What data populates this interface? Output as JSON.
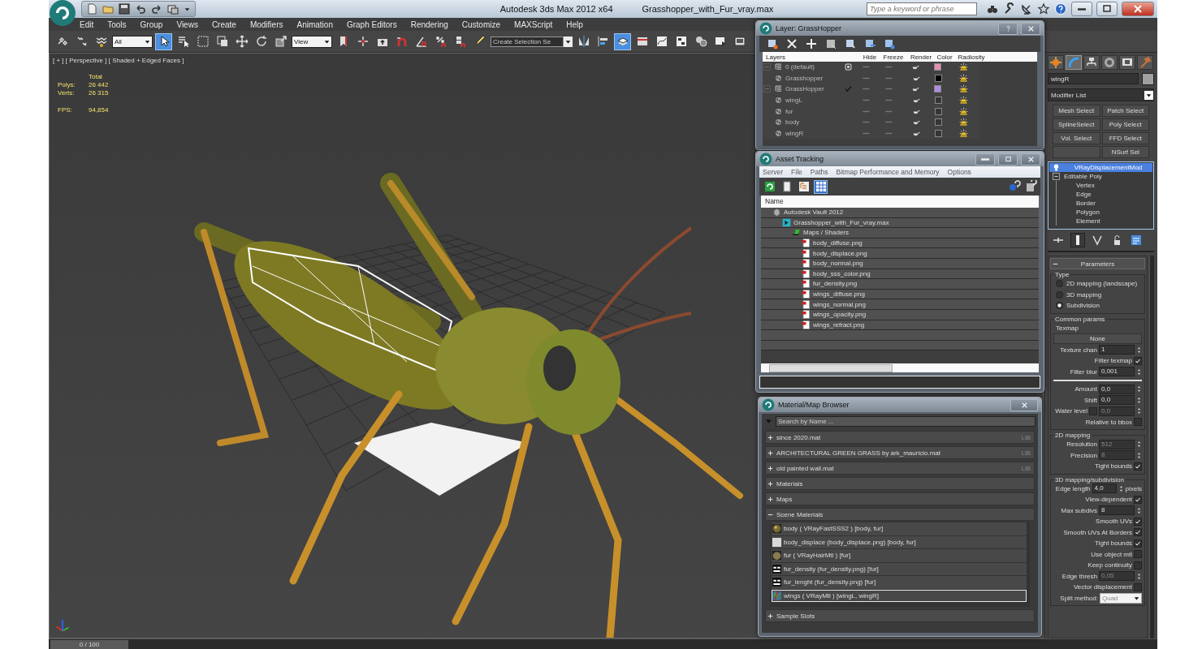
{
  "title_bar": {
    "app_name": "Autodesk 3ds Max 2012 x64",
    "file_name": "Grasshopper_with_Fur_vray.max",
    "search": {
      "placeholder": "Type a keyword or phrase"
    }
  },
  "menu": [
    "Edit",
    "Tools",
    "Group",
    "Views",
    "Create",
    "Modifiers",
    "Animation",
    "Graph Editors",
    "Rendering",
    "Customize",
    "MAXScript",
    "Help"
  ],
  "toolbar": {
    "items": [
      {
        "kind": "icon",
        "selected": false
      },
      {
        "kind": "icon",
        "selected": false
      },
      {
        "kind": "icon",
        "selected": false
      },
      {
        "kind": "dropdown",
        "value": "All"
      },
      {
        "kind": "icon",
        "selected": true
      },
      {
        "kind": "icon",
        "selected": false
      },
      {
        "kind": "icon",
        "selected": false
      },
      {
        "kind": "icon",
        "selected": false
      },
      {
        "kind": "icon",
        "selected": false
      },
      {
        "kind": "icon",
        "selected": false
      },
      {
        "kind": "icon",
        "selected": false
      },
      {
        "kind": "dropdown",
        "value": "View"
      },
      {
        "kind": "icon",
        "selected": false
      },
      {
        "kind": "icon",
        "selected": false
      },
      {
        "kind": "icon",
        "selected": false
      },
      {
        "kind": "icon",
        "selected": false
      },
      {
        "kind": "icon",
        "selected": false
      },
      {
        "kind": "icon",
        "selected": false
      },
      {
        "kind": "icon",
        "selected": false
      },
      {
        "kind": "icon",
        "selected": false
      },
      {
        "kind": "field",
        "placeholder": "Create Selection Se"
      },
      {
        "kind": "icon",
        "selected": false
      },
      {
        "kind": "icon",
        "selected": false
      },
      {
        "kind": "icon",
        "selected": true
      },
      {
        "kind": "icon",
        "selected": false
      },
      {
        "kind": "icon",
        "selected": false
      },
      {
        "kind": "icon",
        "selected": false
      },
      {
        "kind": "icon",
        "selected": false
      },
      {
        "kind": "icon",
        "selected": false
      },
      {
        "kind": "icon",
        "selected": false
      }
    ]
  },
  "viewport": {
    "label": "[ + ] [ Perspective ] [ Shaded + Edged Faces ]",
    "stats_header": "Total",
    "stats": [
      {
        "label": "Polys:",
        "value": "26 442"
      },
      {
        "label": "Verts:",
        "value": "26 315"
      }
    ],
    "fps": {
      "label": "FPS:",
      "value": "94,854"
    }
  },
  "layer_dialog": {
    "title": "Layer: GrassHopper",
    "columns": [
      "Layers",
      "Hide",
      "Freeze",
      "Render",
      "Color",
      "Radiosity"
    ],
    "layers": [
      {
        "name": "0 (default)",
        "expanded": true,
        "current": false,
        "color": "#e890b4",
        "children": [
          {
            "name": "Grasshopper",
            "color": "#000000"
          }
        ]
      },
      {
        "name": "GrassHopper",
        "expanded": true,
        "current": true,
        "color": "#b08ce0",
        "children": [
          {
            "name": "wingL",
            "color": "#353535"
          },
          {
            "name": "fur",
            "color": "#353535"
          },
          {
            "name": "body",
            "color": "#353535"
          },
          {
            "name": "wingR",
            "color": "#353535"
          }
        ]
      }
    ]
  },
  "asset_tracking": {
    "title": "Asset Tracking",
    "menu": [
      "Server",
      "File",
      "Paths",
      "Bitmap Performance and Memory",
      "Options"
    ],
    "tools": [
      {
        "selected": false
      },
      {
        "selected": false
      },
      {
        "selected": false
      },
      {
        "selected": true
      }
    ],
    "column": "Name",
    "tree": [
      {
        "name": "Autodesk Vault 2012",
        "kind": "vault",
        "children": [
          {
            "name": "Grasshopper_with_Fur_vray.max",
            "kind": "scene",
            "children": [
              {
                "name": "Maps / Shaders",
                "kind": "folder",
                "children": [
                  {
                    "name": "body_diffuse.png",
                    "kind": "bitmap"
                  },
                  {
                    "name": "body_displace.png",
                    "kind": "bitmap"
                  },
                  {
                    "name": "body_normal.png",
                    "kind": "bitmap"
                  },
                  {
                    "name": "body_sss_color.png",
                    "kind": "bitmap"
                  },
                  {
                    "name": "fur_density.png",
                    "kind": "bitmap"
                  },
                  {
                    "name": "wings_diffuse.png",
                    "kind": "bitmap"
                  },
                  {
                    "name": "wings_normal.png",
                    "kind": "bitmap"
                  },
                  {
                    "name": "wings_opacity.png",
                    "kind": "bitmap"
                  },
                  {
                    "name": "wings_refract.png",
                    "kind": "bitmap"
                  }
                ]
              }
            ]
          }
        ]
      }
    ]
  },
  "material_browser": {
    "title": "Material/Map Browser",
    "search": {
      "placeholder": "Search by Name ..."
    },
    "groups": [
      {
        "label": "since 2020.mat",
        "expanded": false,
        "badge": "LIB"
      },
      {
        "label": "ARCHITECTURAL GREEN GRASS by ark_mauricio.mat",
        "expanded": false,
        "badge": "LIB"
      },
      {
        "label": "old painted wall.mat",
        "expanded": false,
        "badge": "LIB"
      },
      {
        "label": "Materials",
        "expanded": false
      },
      {
        "label": "Maps",
        "expanded": false
      },
      {
        "label": "Scene Materials",
        "expanded": true,
        "items": [
          {
            "label": "body  ( VRayFastSSS2 ) [body, fur]",
            "kind": "sphere",
            "selected": false
          },
          {
            "label": "body_displace (body_displace.png) [body, fur]",
            "kind": "swatch",
            "selected": false
          },
          {
            "label": "fur  ( VRayHairMtl ) [fur]",
            "kind": "fur",
            "selected": false
          },
          {
            "label": "fur_density (fur_density.png)  [fur]",
            "kind": "map",
            "selected": false
          },
          {
            "label": "fur_lenght (fur_density.png)  [fur]",
            "kind": "map",
            "selected": false
          },
          {
            "label": "wings  ( VRayMtl ) [wingL, wingR]",
            "kind": "noise",
            "selected": true
          }
        ]
      },
      {
        "label": "Sample Slots",
        "expanded": false
      }
    ]
  },
  "command_panel": {
    "tabs": [
      {
        "selected": false
      },
      {
        "selected": true
      },
      {
        "selected": false
      },
      {
        "selected": false
      },
      {
        "selected": false
      },
      {
        "selected": false
      }
    ],
    "object_name": "wingR",
    "modifier_list": "Modifier List",
    "modifier_buttons": [
      {
        "kind": "button",
        "label": "Mesh Select"
      },
      {
        "kind": "button",
        "label": "Patch Select"
      },
      {
        "kind": "button",
        "label": "SplineSelect"
      },
      {
        "kind": "button",
        "label": "Poly Select"
      },
      {
        "kind": "button",
        "label": "Vol. Select"
      },
      {
        "kind": "button",
        "label": "FFD Select"
      },
      {
        "kind": "blank"
      },
      {
        "kind": "button",
        "label": "NSurf Sel"
      }
    ],
    "stack": [
      {
        "label": "VRayDisplacementMod",
        "kind": "modifier",
        "selected": true
      },
      {
        "label": "Editable Poly",
        "kind": "base",
        "selected": false,
        "expanded": true,
        "children": [
          "Vertex",
          "Edge",
          "Border",
          "Polygon",
          "Element"
        ]
      }
    ],
    "stack_tools": [
      {
        "selected": false
      },
      {
        "selected": true
      },
      {
        "selected": false
      },
      {
        "selected": false
      },
      {
        "selected": false
      }
    ],
    "rollout": {
      "title": "Parameters",
      "expanded": true,
      "groups": [
        {
          "title": "Type",
          "rows": [
            {
              "kind": "radio",
              "label": "2D mapping (landscape)",
              "selected": false
            },
            {
              "kind": "radio",
              "label": "3D mapping",
              "selected": false
            },
            {
              "kind": "radio",
              "label": "Subdivision",
              "selected": true
            }
          ]
        },
        {
          "title": "Common params",
          "rows": [
            {
              "kind": "label",
              "label": "Texmap"
            },
            {
              "kind": "button",
              "label": "None"
            },
            {
              "kind": "spinner",
              "label": "Texture chan",
              "value": "1",
              "disabled": false
            },
            {
              "kind": "checkbox",
              "label": "Filter texmap",
              "checked": true
            },
            {
              "kind": "spinner",
              "label": "Filter blur",
              "value": "0,001",
              "disabled": false
            },
            {
              "kind": "divider"
            },
            {
              "kind": "spinner",
              "label": "Amount",
              "value": "0,0",
              "disabled": false
            },
            {
              "kind": "spinner",
              "label": "Shift",
              "value": "0,0",
              "disabled": false
            },
            {
              "kind": "checkspinner",
              "label": "Water level",
              "checked": false,
              "value": "0,0",
              "disabled": true
            },
            {
              "kind": "checkbox",
              "label": "Relative to bbox",
              "checked": false
            }
          ]
        },
        {
          "title": "2D mapping",
          "rows": [
            {
              "kind": "spinner",
              "label": "Resolution",
              "value": "512",
              "disabled": true
            },
            {
              "kind": "spinner",
              "label": "Precision",
              "value": "8",
              "disabled": true
            },
            {
              "kind": "checkbox",
              "label": "Tight bounds",
              "checked": true
            }
          ]
        },
        {
          "title": "3D mapping/subdivision",
          "rows": [
            {
              "kind": "spinner",
              "label": "Edge length",
              "value": "4,0",
              "disabled": false,
              "suffix": "pixels"
            },
            {
              "kind": "checkbox",
              "label": "View-dependent",
              "checked": true
            },
            {
              "kind": "spinner",
              "label": "Max subdivs",
              "value": "8",
              "disabled": false
            },
            {
              "kind": "checkbox",
              "label": "Smooth UVs",
              "checked": true
            },
            {
              "kind": "checkbox",
              "label": "Smooth UVs At Borders",
              "checked": true
            },
            {
              "kind": "checkbox",
              "label": "Tight bounds",
              "checked": true
            },
            {
              "kind": "checkbox",
              "label": "Use object mtl",
              "checked": false
            },
            {
              "kind": "checkbox",
              "label": "Keep continuity",
              "checked": false
            },
            {
              "kind": "spinner",
              "label": "Edge thresh",
              "value": "0,05",
              "disabled": true
            },
            {
              "kind": "checkbox",
              "label": "Vector displacement",
              "checked": false
            },
            {
              "kind": "dropdown",
              "label": "Split method:",
              "value": "Quad"
            }
          ]
        }
      ]
    }
  },
  "timeline": {
    "label": "0 / 100",
    "level": 0
  }
}
